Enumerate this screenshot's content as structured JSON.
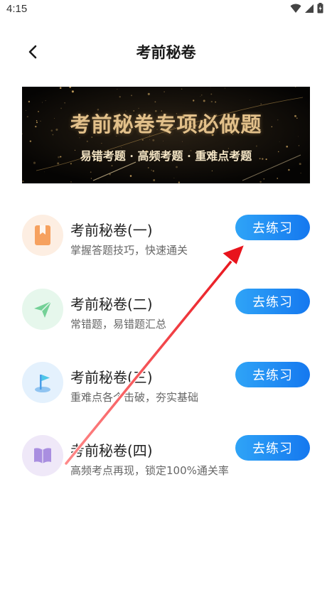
{
  "status_bar": {
    "time": "4:15",
    "icons": [
      "wifi-icon",
      "signal-icon",
      "battery-icon"
    ]
  },
  "header": {
    "back_icon": "chevron-left-icon",
    "title": "考前秘卷"
  },
  "banner": {
    "title": "考前秘卷专项必做题",
    "subtitle": "易错考题 · 高频考题 · 重难点考题"
  },
  "items": [
    {
      "title": "考前秘卷(一)",
      "description": "掌握答题技巧，快速通关",
      "button": "去练习",
      "icon": "bookmark-icon",
      "icon_bg": "#fdeee2",
      "icon_color": "#f6a15f"
    },
    {
      "title": "考前秘卷(二)",
      "description": "常错题，易错题汇总",
      "button": "去练习",
      "icon": "paper-plane-icon",
      "icon_bg": "#e6f7ec",
      "icon_color": "#74d197"
    },
    {
      "title": "考前秘卷(三)",
      "description": "重难点各个击破，夯实基础",
      "button": "去练习",
      "icon": "flag-icon",
      "icon_bg": "#e4f1fd",
      "icon_color": "#4a9ee8"
    },
    {
      "title": "考前秘卷(四)",
      "description": "高频考点再现，锁定100%通关率",
      "button": "去练习",
      "icon": "open-book-icon",
      "icon_bg": "#efe8f8",
      "icon_color": "#a98ee0"
    }
  ],
  "colors": {
    "button_start": "#2fa4f7",
    "button_end": "#1578ef",
    "annotation_arrow": "#e8141c",
    "banner_gold": "#e2c08a"
  }
}
